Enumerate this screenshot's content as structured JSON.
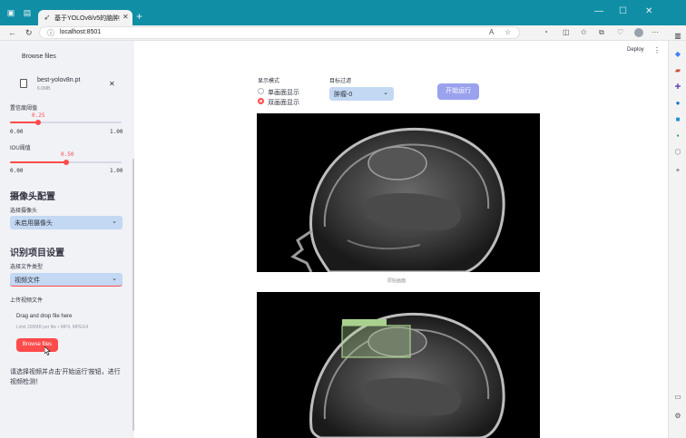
{
  "browser": {
    "tab_title": "基于YOLOv8/v5的脑肿瘤图像检测",
    "url": "localhost:8501",
    "new_tab_symbol": "+",
    "tab_close_symbol": "✕"
  },
  "app": {
    "deploy_label": "Deploy",
    "menu_symbol": "⋮"
  },
  "sidebar": {
    "browse_files_top": "Browse files",
    "uploaded_file": {
      "name": "best-yolov8n.pt",
      "size": "6.0MB",
      "remove_symbol": "✕"
    },
    "confidence": {
      "label": "置信度阈值",
      "value": "0.25",
      "min": "0.00",
      "max": "1.00",
      "fraction": 0.25
    },
    "iou": {
      "label": "IOU阈值",
      "value": "0.50",
      "min": "0.00",
      "max": "1.00",
      "fraction": 0.5
    },
    "camera_section": {
      "title": "摄像头配置",
      "select_label": "选择摄像头",
      "select_value": "未启用摄像头"
    },
    "detect_section": {
      "title": "识别项目设置",
      "file_type_label": "选择文件类型",
      "file_type_value": "视频文件",
      "upload_label": "上传视频文件",
      "drop_text": "Drag and drop file here",
      "limit_text": "Limit 200MB per file • MP4, MPEG4",
      "browse_button": "Browse files"
    },
    "hint": "请选择视频并点击'开始运行'按钮，进行视频检测！"
  },
  "main": {
    "display_mode": {
      "label": "显示模式",
      "options": [
        "单画面显示",
        "双画面显示"
      ],
      "selected_index": 1
    },
    "target_filter": {
      "label": "目标过滤",
      "value": "肿瘤-0"
    },
    "run_button": "开始运行",
    "original_caption": "原始画面"
  },
  "colors": {
    "accent": "#ff4b4b",
    "sidebar_bg": "#f0f2f6",
    "select_bg": "#c3d8f2",
    "run_button_bg": "#9aa2ee",
    "browser_frame": "#0f8ea6",
    "detection_box": "#a9d18e"
  },
  "icons": {
    "chevron": "⌄",
    "back": "←",
    "refresh": "↻",
    "info": "ⓘ"
  }
}
